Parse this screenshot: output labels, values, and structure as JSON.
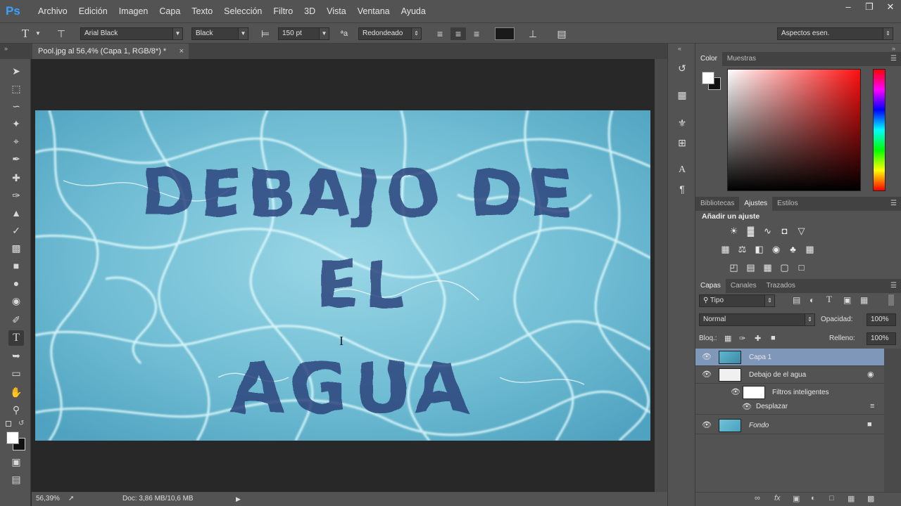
{
  "app": {
    "logo": "Ps"
  },
  "menu": [
    "Archivo",
    "Edición",
    "Imagen",
    "Capa",
    "Texto",
    "Selección",
    "Filtro",
    "3D",
    "Vista",
    "Ventana",
    "Ayuda"
  ],
  "window_controls": {
    "minimize_icon": "minimize-icon",
    "restore_icon": "restore-icon",
    "close_icon": "close-icon"
  },
  "options": {
    "tool_glyph": "T",
    "font_family": "Arial Black",
    "font_style": "Black",
    "font_size": "150 pt",
    "antialias": "Redondeado",
    "text_color": "#1a1a1a",
    "workspace": "Aspectos esen."
  },
  "document": {
    "tab_title": "Pool.jpg al 56,4% (Capa 1, RGB/8*) *",
    "close": "×",
    "text_lines": [
      "DEBAJO DE",
      "EL",
      "AGUA"
    ]
  },
  "status": {
    "zoom": "56,39%",
    "doc": "Doc: 3,86 MB/10,6 MB"
  },
  "panels": {
    "color_tabs": [
      "Color",
      "Muestras"
    ],
    "adjust_tabs": [
      "Bibliotecas",
      "Ajustes",
      "Estilos"
    ],
    "adjust_title": "Añadir un ajuste",
    "layers_tabs": [
      "Capas",
      "Canales",
      "Trazados"
    ],
    "filter_kind": "Tipo",
    "blend_mode": "Normal",
    "opacity_label": "Opacidad:",
    "opacity_value": "100%",
    "lock_label": "Bloq.:",
    "fill_label": "Relleno:",
    "fill_value": "100%",
    "layers": {
      "capa1": "Capa 1",
      "smart": "Debajo de  el  agua",
      "filters": "Filtros inteligentes",
      "displace": "Desplazar",
      "background": "Fondo"
    }
  },
  "colors": {
    "accent_selected_layer": "#7f97b8",
    "water": "#79c4d8"
  }
}
